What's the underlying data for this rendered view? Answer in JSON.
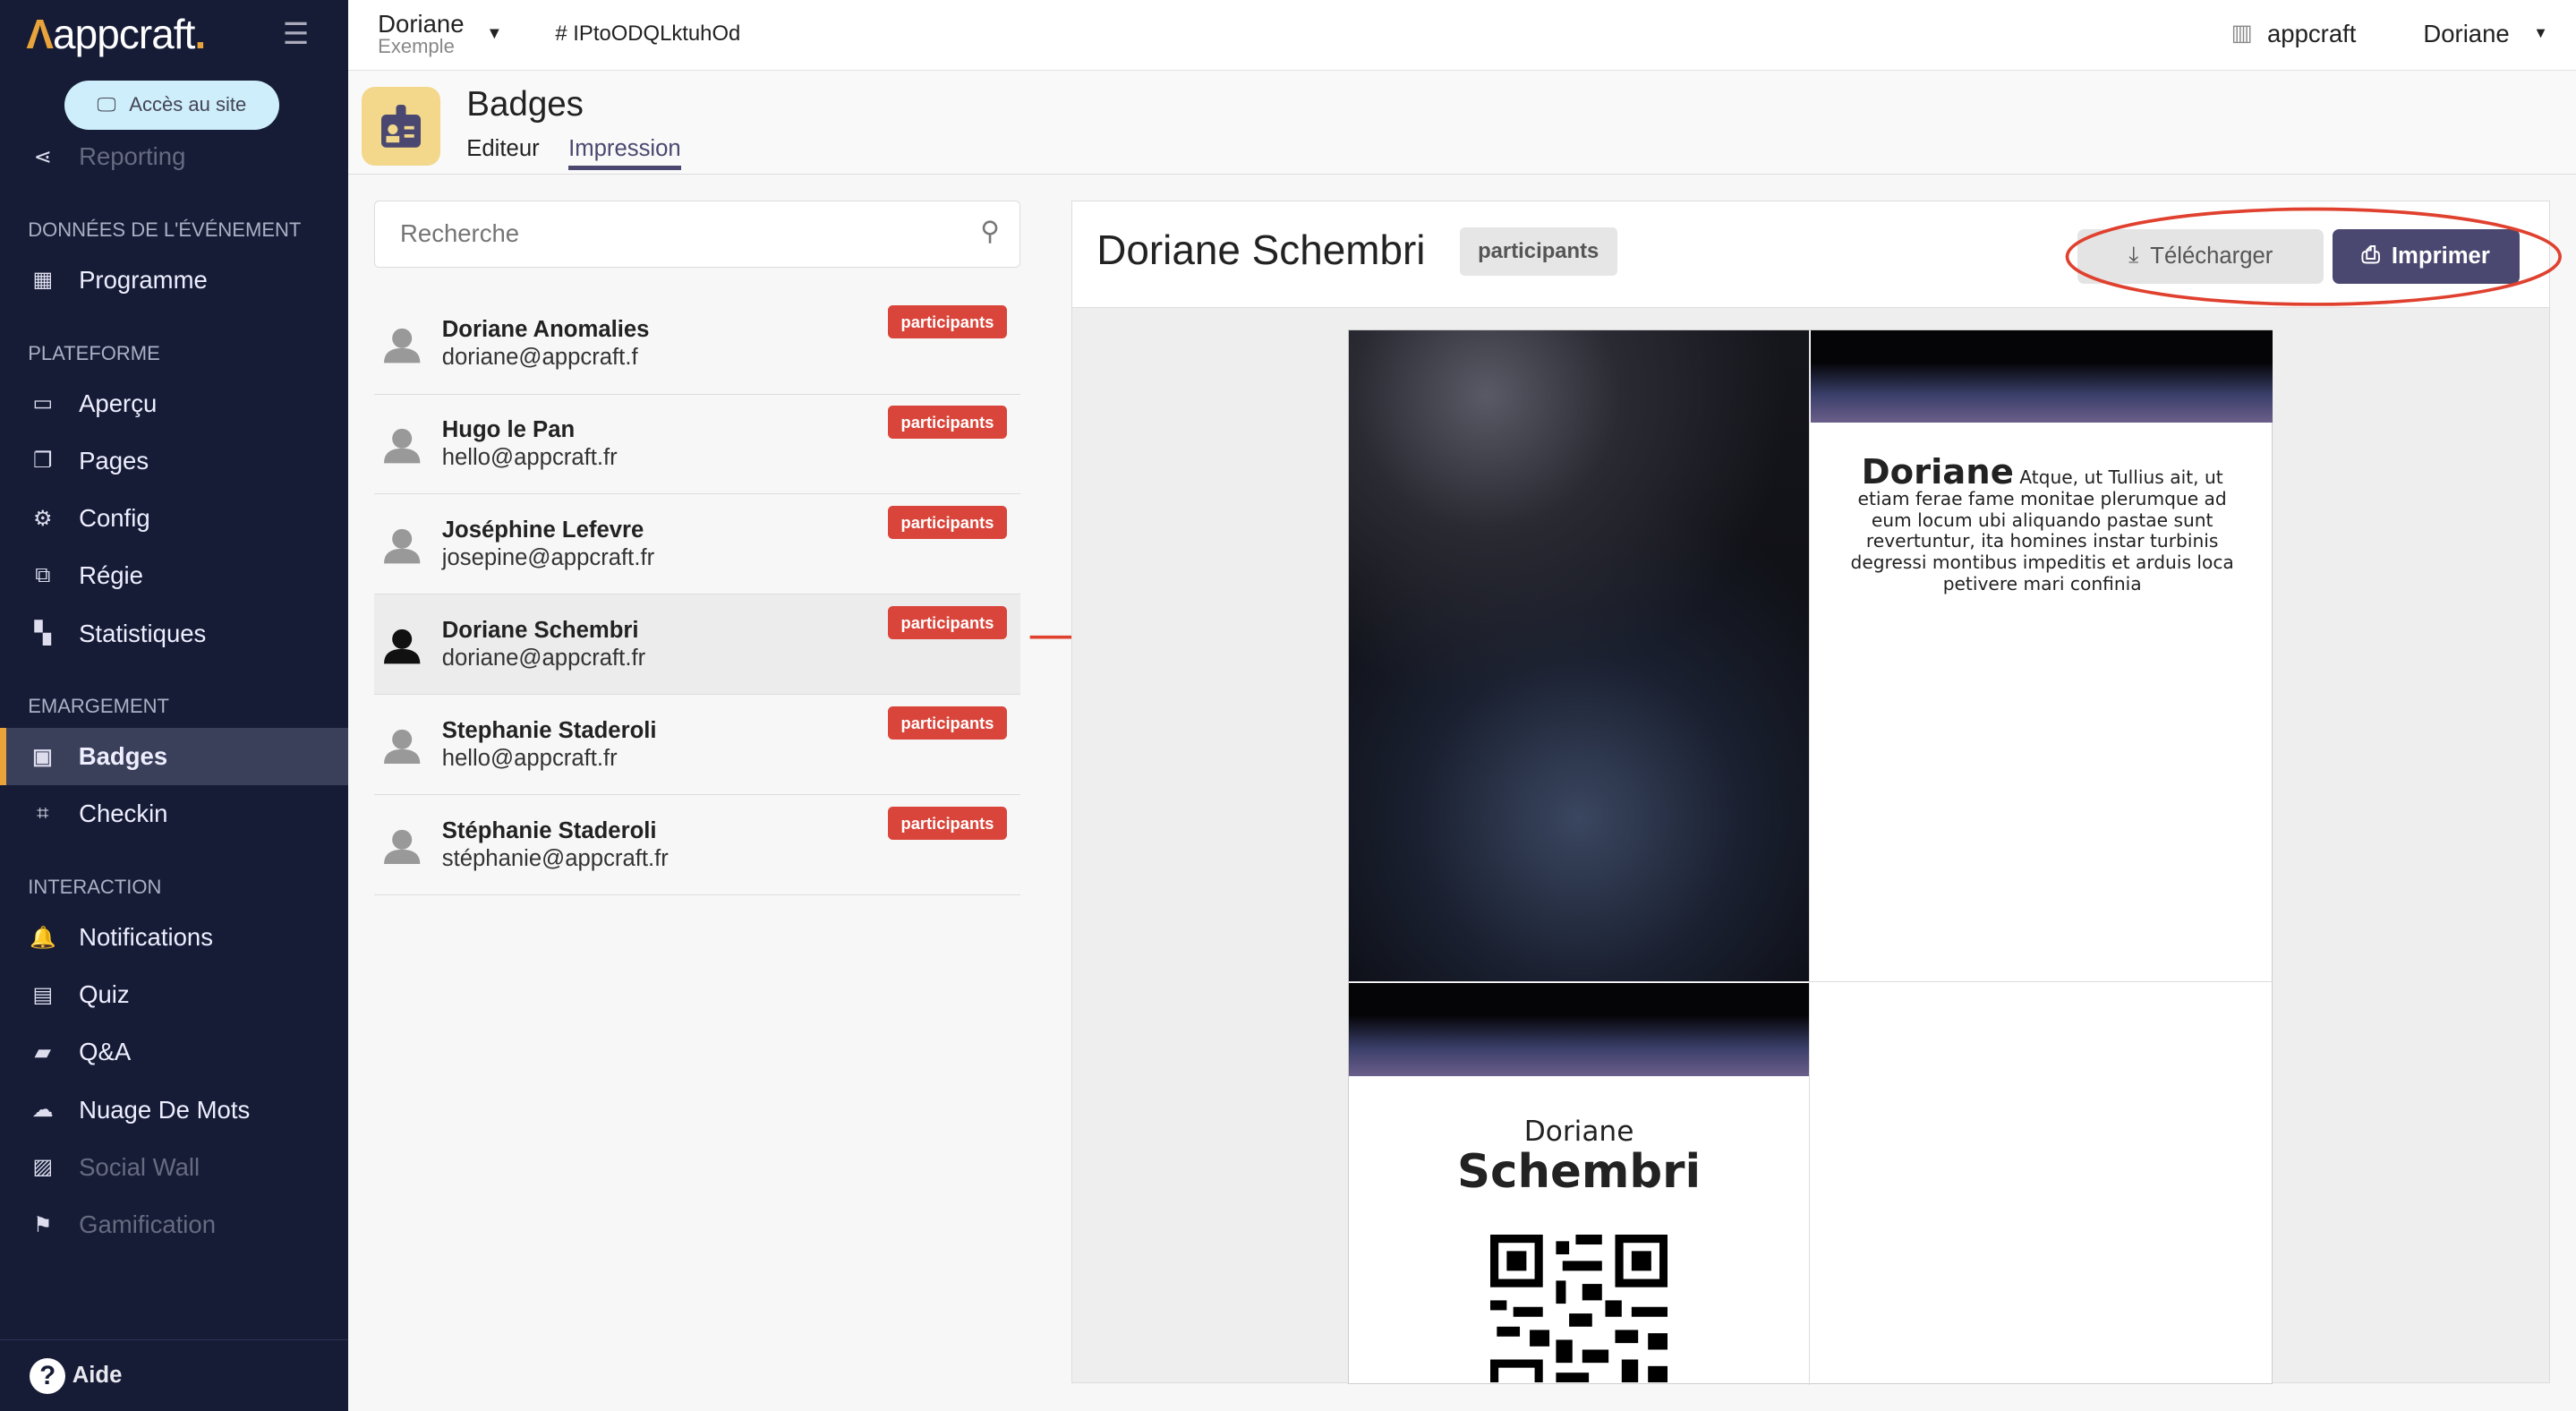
{
  "sidebar": {
    "logo": "appcraft",
    "site_button": "Accès au site",
    "items": [
      {
        "type": "item",
        "label": "Reporting",
        "icon": "share-icon"
      },
      {
        "type": "section",
        "label": "Données de l'événement"
      },
      {
        "type": "item",
        "label": "Programme",
        "icon": "calendar-icon"
      },
      {
        "type": "section",
        "label": "Plateforme"
      },
      {
        "type": "item",
        "label": "Aperçu",
        "icon": "laptop-icon"
      },
      {
        "type": "item",
        "label": "Pages",
        "icon": "copy-icon"
      },
      {
        "type": "item",
        "label": "Config",
        "icon": "config-icon"
      },
      {
        "type": "item",
        "label": "Régie",
        "icon": "screen-icon"
      },
      {
        "type": "item",
        "label": "Statistiques",
        "icon": "grid-icon"
      },
      {
        "type": "section",
        "label": "Emargement"
      },
      {
        "type": "item",
        "label": "Badges",
        "icon": "badge-icon",
        "active": true
      },
      {
        "type": "item",
        "label": "Checkin",
        "icon": "qr-icon"
      },
      {
        "type": "section",
        "label": "Interaction"
      },
      {
        "type": "item",
        "label": "Notifications",
        "icon": "bell-icon"
      },
      {
        "type": "item",
        "label": "Quiz",
        "icon": "quiz-icon"
      },
      {
        "type": "item",
        "label": "Q&A",
        "icon": "chat-icon"
      },
      {
        "type": "item",
        "label": "Nuage De Mots",
        "icon": "cloud-icon"
      },
      {
        "type": "item",
        "label": "Social Wall",
        "icon": "image-icon"
      },
      {
        "type": "item",
        "label": "Gamification",
        "icon": "trophy-icon"
      }
    ],
    "help": "Aide"
  },
  "topbar": {
    "event_name": "Doriane",
    "event_sub": "Exemple",
    "event_id": "# IPtoODQLktuhOd",
    "org": "appcraft",
    "user": "Doriane"
  },
  "header": {
    "title": "Badges",
    "tabs": [
      "Editeur",
      "Impression"
    ],
    "active_tab": "Impression"
  },
  "search": {
    "placeholder": "Recherche"
  },
  "participants": [
    {
      "name": "Doriane Anomalies",
      "email": "doriane@appcraft.f",
      "tag": "participants"
    },
    {
      "name": "Hugo le Pan",
      "email": "hello@appcraft.fr",
      "tag": "participants"
    },
    {
      "name": "Joséphine Lefevre",
      "email": "josepine@appcraft.fr",
      "tag": "participants"
    },
    {
      "name": "Doriane Schembri",
      "email": "doriane@appcraft.fr",
      "tag": "participants",
      "selected": true
    },
    {
      "name": "Stephanie Staderoli",
      "email": "hello@appcraft.fr",
      "tag": "participants"
    },
    {
      "name": "Stéphanie Staderoli",
      "email": "stéphanie@appcraft.fr",
      "tag": "participants"
    }
  ],
  "preview": {
    "name": "Doriane Schembri",
    "group": "participants",
    "download": "Télécharger",
    "print": "Imprimer",
    "badge_first": "Doriane",
    "badge_last": "Schembri",
    "badge_text": "Atque, ut Tullius ait, ut etiam ferae fame monitae plerumque ad eum locum ubi aliquando pastae sunt revertuntur, ita homines instar turbinis degressi montibus impeditis et arduis loca petivere mari confinia"
  },
  "colors": {
    "sidebar": "#161c36",
    "accent": "#4a4870",
    "tag": "#d9453b",
    "annotation": "#e0412f"
  }
}
